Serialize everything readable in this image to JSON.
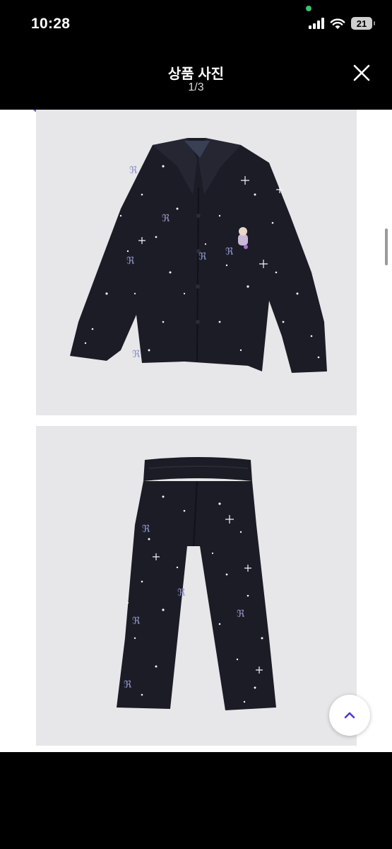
{
  "status_bar": {
    "time": "10:28",
    "battery_level": "21",
    "icons": [
      "signal-icon",
      "wifi-icon",
      "battery-icon"
    ]
  },
  "header": {
    "title": "상품 사진",
    "counter": "1/3",
    "close_icon": "close-icon"
  },
  "gallery": {
    "photos": [
      {
        "subject": "pajama-top",
        "background": "#e7e7ea",
        "garment_color": "#1c1c26"
      },
      {
        "subject": "pajama-pants",
        "background": "#e7e7ea",
        "garment_color": "#1c1c26"
      }
    ]
  },
  "floating": {
    "scroll_top_icon": "chevron-up-icon",
    "accent": "#4a3cd1"
  }
}
